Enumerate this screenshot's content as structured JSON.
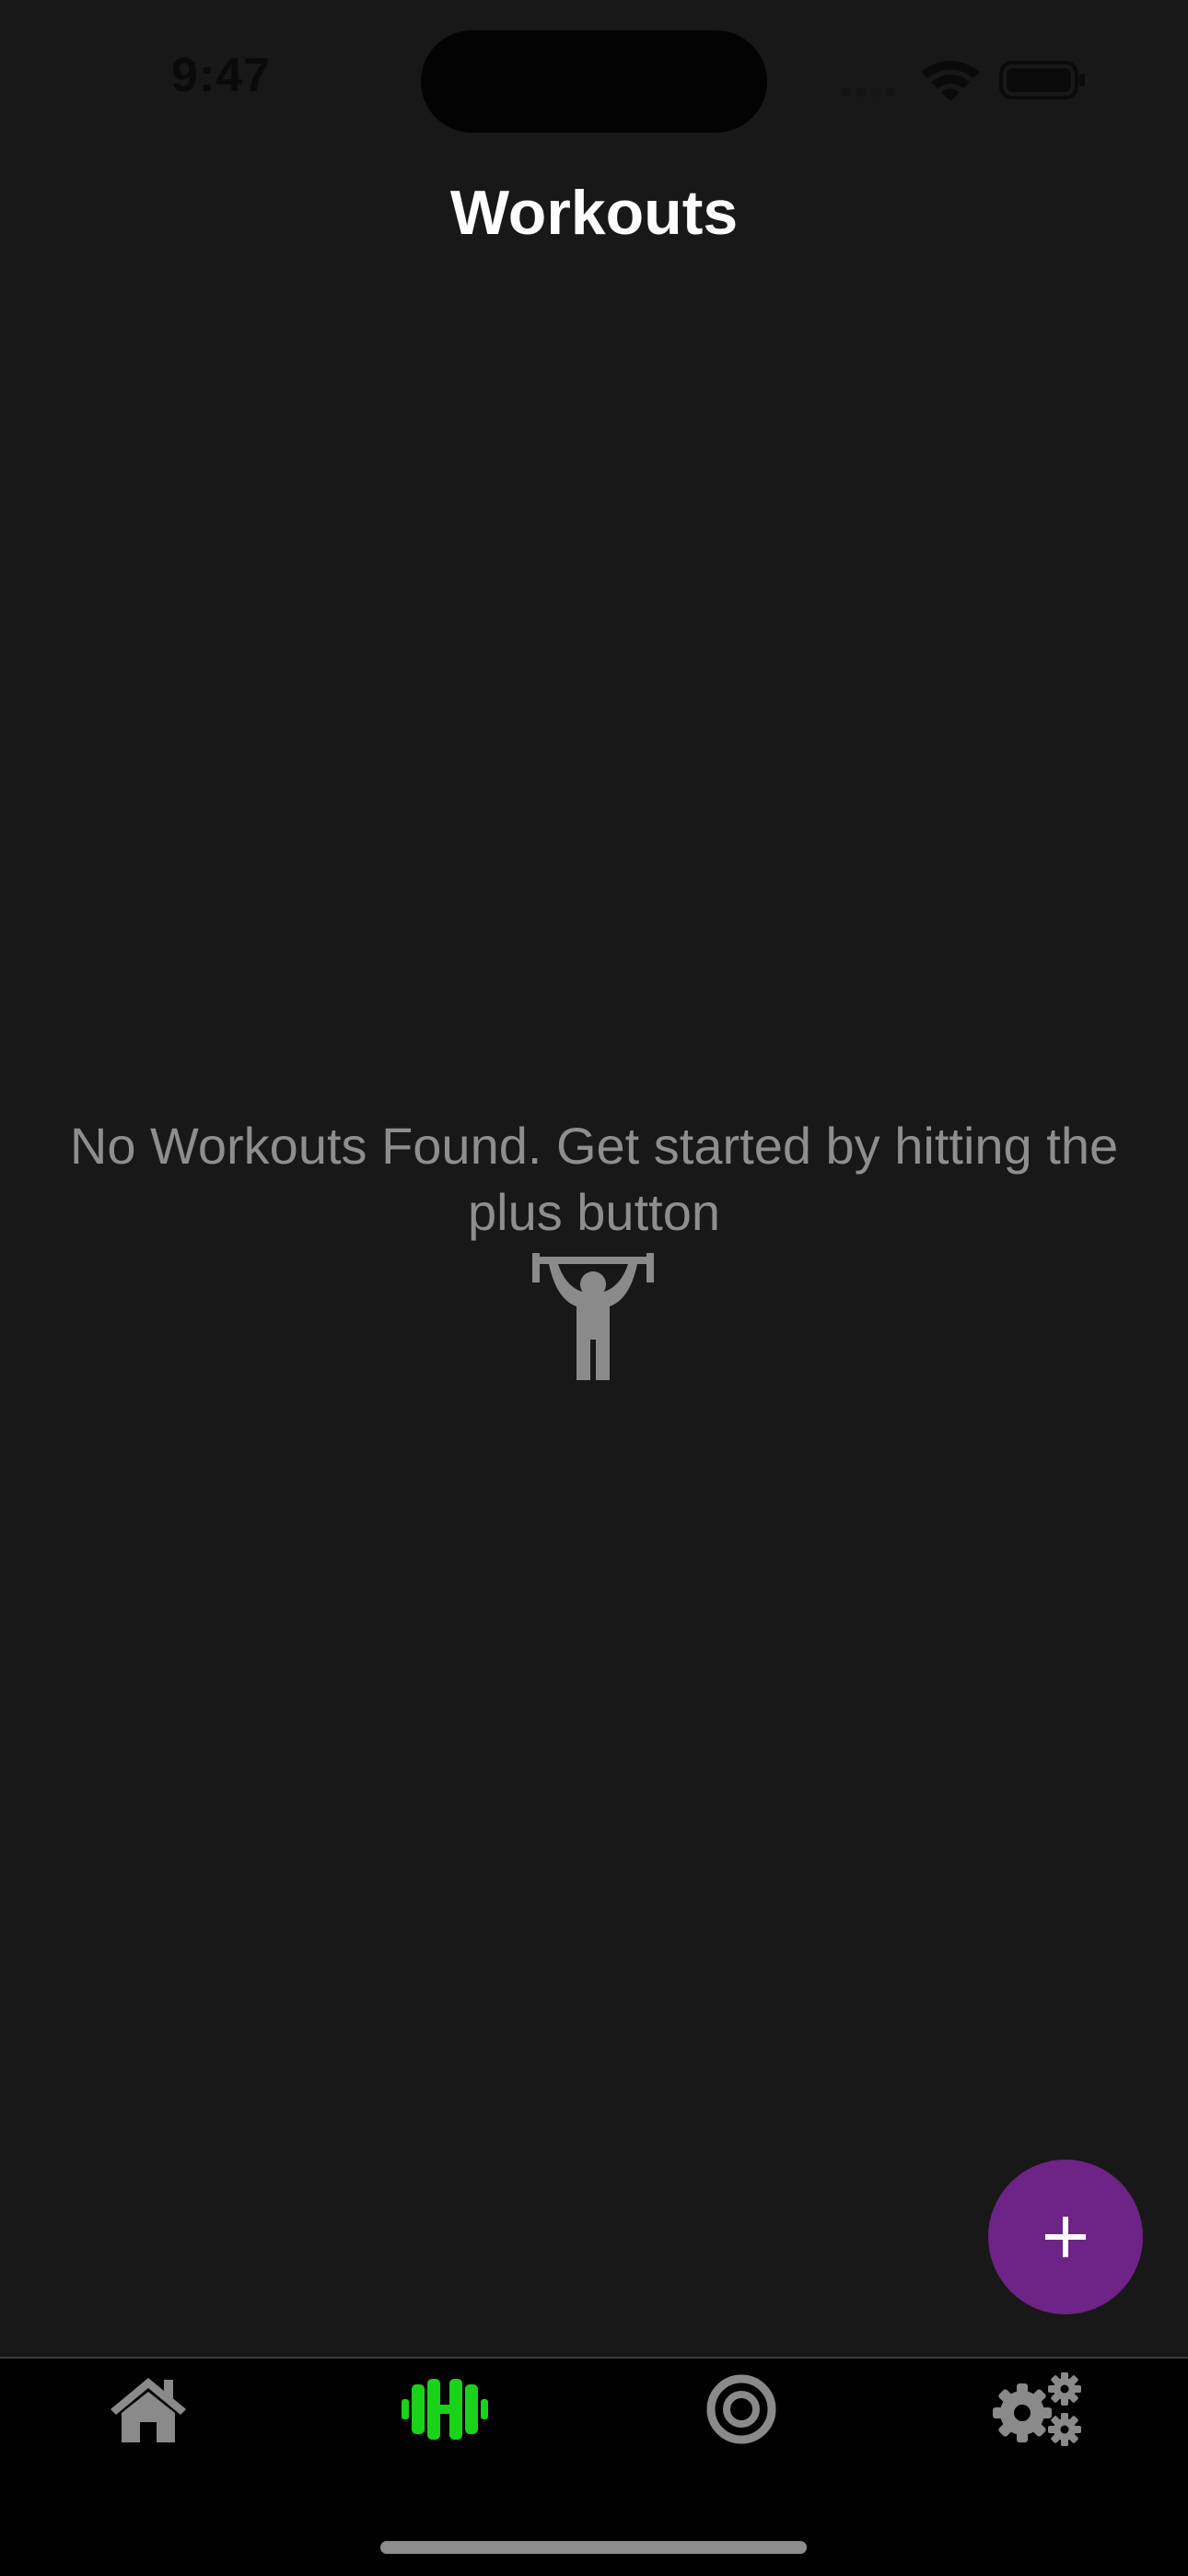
{
  "status_bar": {
    "time": "9:47"
  },
  "header": {
    "title": "Workouts"
  },
  "empty_state": {
    "message": "No Workouts Found. Get started by hitting the plus button",
    "icon": "weightlifter-icon"
  },
  "fab": {
    "icon": "plus-icon",
    "color": "#6e2386"
  },
  "tab_bar": {
    "tabs": [
      {
        "id": "home",
        "icon": "home-icon",
        "active": false
      },
      {
        "id": "workouts",
        "icon": "dumbbell-icon",
        "active": true
      },
      {
        "id": "goals",
        "icon": "target-icon",
        "active": false
      },
      {
        "id": "settings",
        "icon": "gears-icon",
        "active": false
      }
    ],
    "active_color": "#19d219",
    "inactive_color": "#8a8a8a"
  },
  "colors": {
    "background": "#181818",
    "tab_bar_background": "#000000",
    "title": "#ffffff",
    "muted_text": "#8e8e8e"
  }
}
